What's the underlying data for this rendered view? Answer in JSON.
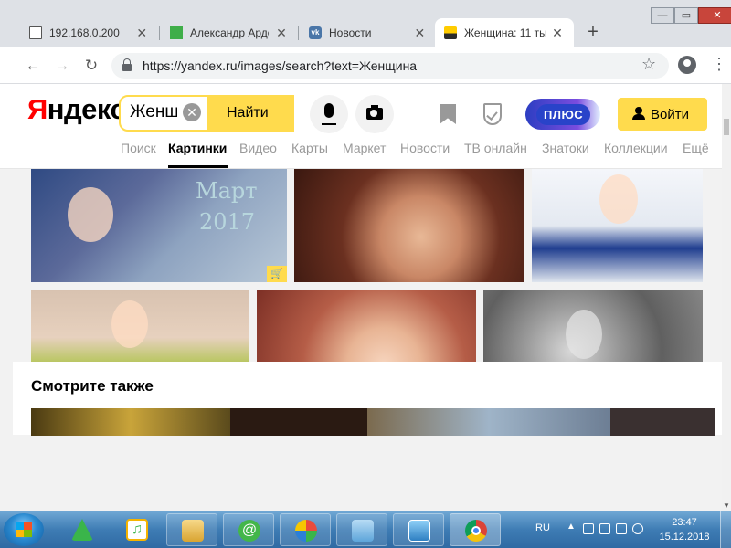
{
  "browser": {
    "tabs": [
      {
        "title": "192.168.0.200",
        "icon": "document-icon",
        "active": false
      },
      {
        "title": "Александр Ардо",
        "icon": "green-square-icon",
        "active": false
      },
      {
        "title": "Новости",
        "icon": "vk-icon",
        "active": false
      },
      {
        "title": "Женщина: 11 ты",
        "icon": "yandex-images-icon",
        "active": true
      }
    ],
    "new_tab": "+",
    "url": "https://yandex.ru/images/search?text=Женщина",
    "window_controls": {
      "minimize": "—",
      "maximize": "▭",
      "close": "✕"
    }
  },
  "yandex": {
    "logo_first": "Я",
    "logo_rest": "ндекс",
    "search_value": "Женщ",
    "search_button": "Найти",
    "plus_label": "ПЛЮС",
    "login_label": "Войти",
    "services": [
      "Поиск",
      "Картинки",
      "Видео",
      "Карты",
      "Маркет",
      "Новости",
      "ТВ онлайн",
      "Знатоки",
      "Коллекции",
      "Ещё"
    ],
    "active_service": "Картинки",
    "colors": {
      "accent": "#ffdb4d",
      "logo_red": "#ff0000"
    }
  },
  "results": {
    "image_1_text_line1": "Март",
    "image_1_text_line2": "2017",
    "see_also_title": "Смотрите также"
  },
  "taskbar": {
    "language": "RU",
    "time": "23:47",
    "date": "15.12.2018",
    "apps": [
      "android-icon",
      "music-icon",
      "explorer-icon",
      "mail-agent-icon",
      "paint-icon",
      "notepad-icon",
      "control-panel-icon",
      "chrome-icon"
    ]
  }
}
